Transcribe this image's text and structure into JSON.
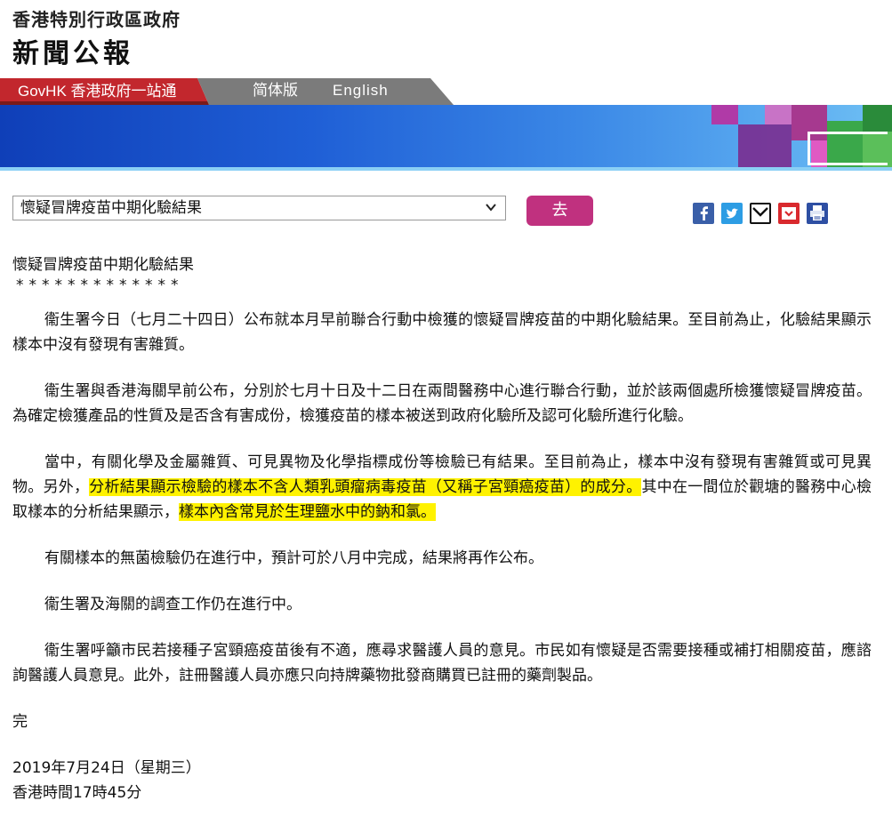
{
  "header": {
    "govt_name": "香港特別行政區政府",
    "press_title": "新聞公報"
  },
  "nav": {
    "govhk": "GovHK 香港政府一站通",
    "simplified": "简体版",
    "english": "English"
  },
  "toolbar": {
    "selector_value": "懷疑冒牌疫苗中期化驗結果",
    "go_label": "去"
  },
  "share": {
    "facebook": "facebook-icon",
    "twitter": "twitter-icon",
    "email": "email-icon",
    "save": "save-icon",
    "print": "print-icon"
  },
  "article": {
    "title": "懷疑冒牌疫苗中期化驗結果",
    "stars": "*************",
    "para1": "衞生署今日（七月二十四日）公布就本月早前聯合行動中檢獲的懷疑冒牌疫苗的中期化驗結果。至目前為止，化驗結果顯示樣本中沒有發現有害雜質。",
    "para2": "衞生署與香港海關早前公布，分別於七月十日及十二日在兩間醫務中心進行聯合行動，並於該兩個處所檢獲懷疑冒牌疫苗。為確定檢獲產品的性質及是否含有害成份，檢獲疫苗的樣本被送到政府化驗所及認可化驗所進行化驗。",
    "para3_a": "當中，有關化學及金屬雜質、可見異物及化學指標成份等檢驗已有結果。至目前為止，樣本中沒有發現有害雜質或可見異物。另外，",
    "para3_hl1": "分析結果顯示檢驗的樣本不含人類乳頭瘤病毒疫苗（又稱子宮頸癌疫苗）的成分。",
    "para3_b": "其中在一間位於觀塘的醫務中心檢取樣本的分析結果顯示，",
    "para3_hl2": "樣本內含常見於生理鹽水中的鈉和氯。",
    "para4": "有關樣本的無菌檢驗仍在進行中，預計可於八月中完成，結果將再作公布。",
    "para5": "衞生署及海關的調查工作仍在進行中。",
    "para6": "衞生署呼籲市民若接種子宮頸癌疫苗後有不適，應尋求醫護人員的意見。市民如有懷疑是否需要接種或補打相關疫苗，應諮詢醫護人員意見。此外，註冊醫護人員亦應只向持牌藥物批發商購買已註冊的藥劑製品。",
    "end": "完",
    "date": "2019年7月24日（星期三）",
    "time": "香港時間17時45分"
  },
  "colors": {
    "govhk_red": "#c2272d",
    "go_button": "#c0317f",
    "highlight": "#fff200",
    "banner_blue": "#1f5fd6"
  }
}
